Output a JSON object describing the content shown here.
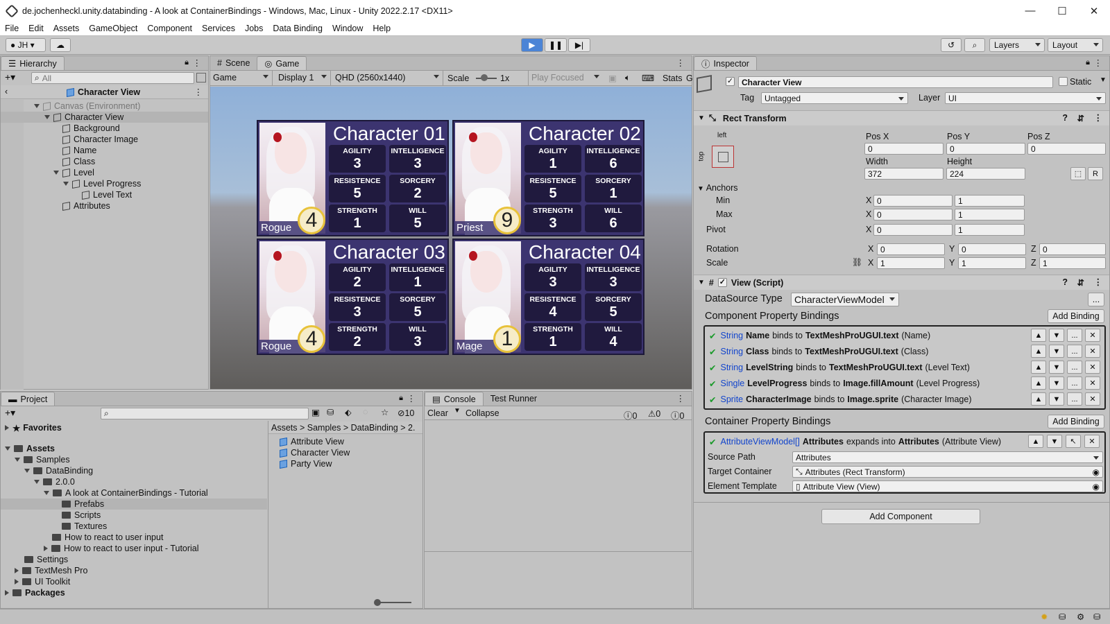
{
  "window": {
    "title": "de.jochenheckl.unity.databinding - A look at ContainerBindings - Windows, Mac, Linux - Unity 2022.2.17 <DX11>"
  },
  "menu": [
    "File",
    "Edit",
    "Assets",
    "GameObject",
    "Component",
    "Services",
    "Jobs",
    "Data Binding",
    "Window",
    "Help"
  ],
  "toolbar": {
    "account": "JH",
    "layers": "Layers",
    "layout": "Layout"
  },
  "hierarchy": {
    "tab": "Hierarchy",
    "search_placeholder": "All",
    "breadcrumb": "Character View",
    "items": [
      "Canvas (Environment)",
      "Character View",
      "Background",
      "Character Image",
      "Name",
      "Class",
      "Level",
      "Level Progress",
      "Level Text",
      "Attributes"
    ]
  },
  "scene_tabs": {
    "scene": "Scene",
    "game": "Game"
  },
  "game_toolbar": {
    "mode": "Game",
    "display": "Display 1",
    "resolution": "QHD (2560x1440)",
    "scale_label": "Scale",
    "scale_value": "1x",
    "play_focused": "Play Focused",
    "stats": "Stats",
    "gizmos": "G"
  },
  "attribute_names": [
    "AGILITY",
    "INTELLIGENCE",
    "RESISTENCE",
    "SORCERY",
    "STRENGTH",
    "WILL"
  ],
  "characters": [
    {
      "name": "Character 01",
      "class": "Rogue",
      "level": "4",
      "attrs": [
        "3",
        "3",
        "5",
        "2",
        "1",
        "5"
      ]
    },
    {
      "name": "Character 02",
      "class": "Priest",
      "level": "9",
      "attrs": [
        "1",
        "6",
        "5",
        "1",
        "3",
        "6"
      ]
    },
    {
      "name": "Character 03",
      "class": "Rogue",
      "level": "4",
      "attrs": [
        "2",
        "1",
        "3",
        "5",
        "2",
        "3"
      ]
    },
    {
      "name": "Character 04",
      "class": "Mage",
      "level": "1",
      "attrs": [
        "3",
        "3",
        "4",
        "5",
        "1",
        "4"
      ]
    }
  ],
  "inspector": {
    "tab": "Inspector",
    "object_name": "Character View",
    "static_label": "Static",
    "tag_label": "Tag",
    "tag_value": "Untagged",
    "layer_label": "Layer",
    "layer_value": "UI",
    "rect_transform": {
      "header": "Rect Transform",
      "anchor_h": "left",
      "anchor_v": "top",
      "labels": {
        "posx": "Pos X",
        "posy": "Pos Y",
        "posz": "Pos Z",
        "width": "Width",
        "height": "Height",
        "anchors": "Anchors",
        "min": "Min",
        "max": "Max",
        "pivot": "Pivot",
        "rotation": "Rotation",
        "scale": "Scale",
        "x": "X",
        "y": "Y",
        "z": "Z",
        "r": "R"
      },
      "posx": "0",
      "posy": "0",
      "posz": "0",
      "width": "372",
      "height": "224",
      "min_x": "0",
      "min_y": "1",
      "max_x": "0",
      "max_y": "1",
      "pivot_x": "0",
      "pivot_y": "1",
      "rot_x": "0",
      "rot_y": "0",
      "rot_z": "0",
      "scale_x": "1",
      "scale_y": "1",
      "scale_z": "1"
    },
    "view_script": {
      "header": "View (Script)",
      "datasource_label": "DataSource Type",
      "datasource_value": "CharacterViewModel",
      "datasource_btn": "...",
      "component_bindings_label": "Component Property Bindings",
      "add_binding": "Add Binding",
      "bindings": [
        {
          "type": "String",
          "prop": "Name",
          "mid": "binds to",
          "target": "TextMeshProUGUI.text",
          "obj": "(Name)"
        },
        {
          "type": "String",
          "prop": "Class",
          "mid": "binds to",
          "target": "TextMeshProUGUI.text",
          "obj": "(Class)"
        },
        {
          "type": "String",
          "prop": "LevelString",
          "mid": "binds to",
          "target": "TextMeshProUGUI.text",
          "obj": "(Level Text)"
        },
        {
          "type": "Single",
          "prop": "LevelProgress",
          "mid": "binds to",
          "target": "Image.fillAmount",
          "obj": "(Level Progress)"
        },
        {
          "type": "Sprite",
          "prop": "CharacterImage",
          "mid": "binds to",
          "target": "Image.sprite",
          "obj": "(Character Image)"
        }
      ],
      "container_bindings_label": "Container Property Bindings",
      "container_binding": {
        "type": "AttributeViewModel[]",
        "prop": "Attributes",
        "mid": "expands into",
        "target": "Attributes",
        "obj": "(Attribute View)"
      },
      "source_path_label": "Source Path",
      "source_path_value": "Attributes",
      "target_container_label": "Target Container",
      "target_container_value": "Attributes (Rect Transform)",
      "element_template_label": "Element Template",
      "element_template_value": "Attribute View (View)"
    },
    "add_component": "Add Component"
  },
  "project": {
    "tab": "Project",
    "hidden_count": "10",
    "tree": [
      "Favorites",
      "Assets",
      "Samples",
      "DataBinding",
      "2.0.0",
      "A look at ContainerBindings - Tutorial",
      "Prefabs",
      "Scripts",
      "Textures",
      "How to react to user input",
      "How to react to user input - Tutorial",
      "Settings",
      "TextMesh Pro",
      "UI Toolkit",
      "Packages"
    ],
    "breadcrumb": [
      "Assets",
      "Samples",
      "DataBinding",
      "2."
    ],
    "files": [
      "Attribute View",
      "Character View",
      "Party View"
    ]
  },
  "console": {
    "tab": "Console",
    "tab2": "Test Runner",
    "clear": "Clear",
    "collapse": "Collapse",
    "info": "0",
    "warn": "0",
    "err": "0"
  }
}
